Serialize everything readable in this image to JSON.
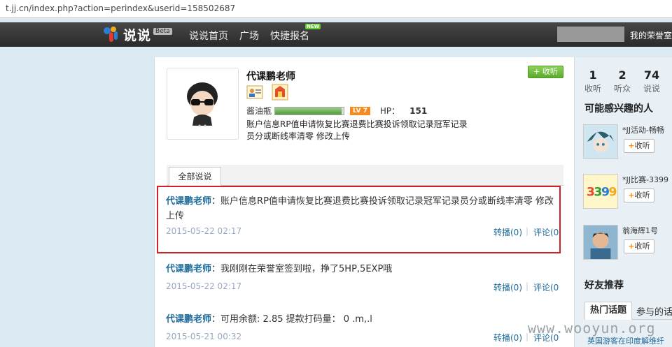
{
  "browser": {
    "url": "t.jj.cn/index.php?action=perindex&userid=158502687"
  },
  "nav": {
    "logo_text": "说说",
    "beta": "Beta",
    "items": [
      "说说首页",
      "广场",
      "快捷报名"
    ],
    "new_badge": "NEW",
    "right_text": "我的荣誉室"
  },
  "profile": {
    "name": "代课鹏老师",
    "follow_label": "+ 收听",
    "level_name": "酱油瓶",
    "level_badge": "LV 7",
    "level_progress": 0.97,
    "hp_label": "HP：",
    "hp_value": "151",
    "description": "账户信息RP值申请恢复比赛退费比赛投诉领取记录冠军记录员分或断线率清零 修改上传"
  },
  "tabs": {
    "all": "全部说说"
  },
  "posts": [
    {
      "author": "代课鹏老师",
      "sep": "：",
      "text": "账户信息RP值申请恢复比赛退费比赛投诉领取记录冠军记录员分或断线率清零 修改 上传",
      "date": "2015-05-22 02:17",
      "repost": "转播(0)",
      "comment": "评论(0"
    },
    {
      "author": "代课鹏老师",
      "sep": "：",
      "text": "我刚刚在荣誉室签到啦，挣了5HP,5EXP哦",
      "date": "2015-05-22 02:17",
      "repost": "转播(0)",
      "comment": "评论(0"
    },
    {
      "author": "代课鹏老师",
      "sep": "：",
      "text": "可用余额: 2.85 提款打码量： 0 .m,.l",
      "date": "2015-05-21 00:32",
      "repost": "转播(0)",
      "comment": "评论(0"
    }
  ],
  "sidebar": {
    "stats": [
      {
        "n": "1",
        "l": "收听"
      },
      {
        "n": "2",
        "l": "听众"
      },
      {
        "n": "74",
        "l": "说说"
      }
    ],
    "interest_title": "可能感兴趣的人",
    "users": [
      {
        "name": "*JJ活动-畅畅",
        "btn": "收听"
      },
      {
        "name": "*JJ比赛-3399",
        "btn": "收听"
      },
      {
        "name": "翁海辉1号",
        "btn": "收听"
      }
    ],
    "friend_title": "好友推荐",
    "hot_tab": "热门话题",
    "join_tab": "参与的话",
    "hot_link": "英国游客在印度解维纤"
  },
  "watermark": "www.wooyun.org"
}
